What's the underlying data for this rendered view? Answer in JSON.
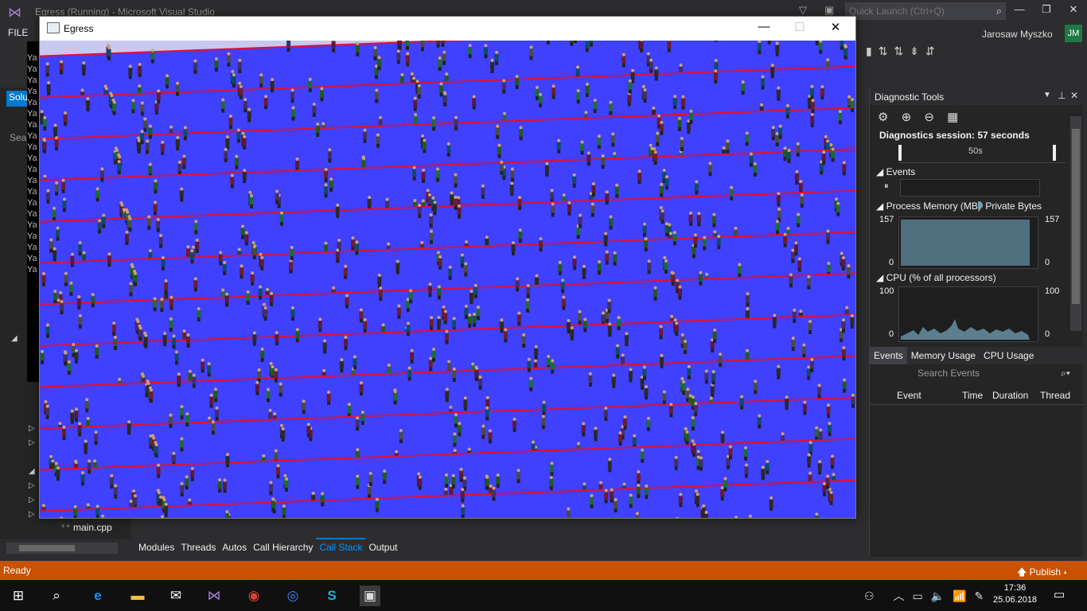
{
  "vs": {
    "title": "Egress (Running) - Microsoft Visual Studio",
    "quick_launch_placeholder": "Quick Launch (Ctrl+Q)",
    "menu_file": "FILE",
    "user_name": "Jarosaw Myszko",
    "user_initials": "JM",
    "left_tab": "Solu",
    "left_search": "Sear",
    "output_line": "Ya",
    "tree_item": "main.cpp",
    "status": "Ready",
    "publish": "Publish"
  },
  "bottom_tabs": [
    "Modules",
    "Threads",
    "Autos",
    "Call Hierarchy",
    "Call Stack",
    "Output"
  ],
  "bottom_tabs_active": "Call Stack",
  "diagnostic": {
    "title": "Diagnostic Tools",
    "session": "Diagnostics session: 57 seconds",
    "timeline_label": "50s",
    "events_label": "Events",
    "memory_label": "Process Memory (MB)",
    "memory_legend": "Private Bytes",
    "memory_max": "157",
    "memory_min": "0",
    "cpu_label": "CPU (% of all processors)",
    "cpu_max": "100",
    "cpu_min": "0",
    "tabs": [
      "Events",
      "Memory Usage",
      "CPU Usage"
    ],
    "search_placeholder": "Search Events",
    "columns": [
      "Event",
      "Time",
      "Duration",
      "Thread"
    ],
    "accent_memory": "#4f6f7e",
    "accent_cpu": "#5c7e8f"
  },
  "egress": {
    "title": "Egress",
    "floor_color": "#4040ff",
    "edge_color": "#dd1133",
    "sky_color": "#c8c8f0"
  },
  "taskbar": {
    "time": "17:36",
    "date": "25.06.2018",
    "icons": [
      "start-icon",
      "search-icon",
      "edge-icon",
      "explorer-icon",
      "mail-icon",
      "visual-studio-icon",
      "chrome-icon",
      "messenger-icon",
      "skype-icon",
      "app-window-icon"
    ]
  }
}
